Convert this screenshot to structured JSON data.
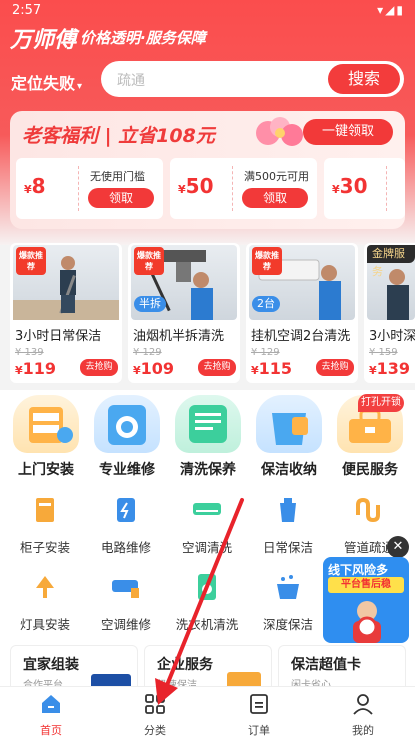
{
  "status": {
    "time": "2:57",
    "icons": "▾◢▮"
  },
  "header": {
    "brand": "万师傅",
    "slogan": "价格透明·服务保障",
    "location": "定位失败",
    "location_arrow": "▾"
  },
  "search": {
    "placeholder": "疏通",
    "button": "搜索"
  },
  "promo": {
    "title": "老客福利 | 立省108元",
    "claim_all": "一键领取",
    "coupons": [
      {
        "currency": "¥",
        "amount": "8",
        "desc": "无使用门槛",
        "button": "领取"
      },
      {
        "currency": "¥",
        "amount": "50",
        "desc": "满500元可用",
        "button": "领取"
      },
      {
        "currency": "¥",
        "amount": "30",
        "desc": "",
        "button": ""
      }
    ]
  },
  "hot_cards": [
    {
      "hot": "爆款推荐",
      "tag": "",
      "name": "3小时日常保洁",
      "old": "¥ 139",
      "currency": "¥",
      "price": "119",
      "buy": "去抢购"
    },
    {
      "hot": "爆款推荐",
      "tag": "半拆",
      "name": "油烟机半拆清洗",
      "old": "¥ 129",
      "currency": "¥",
      "price": "109",
      "buy": "去抢购"
    },
    {
      "hot": "爆款推荐",
      "tag": "2台",
      "name": "挂机空调2台清洗",
      "old": "¥ 129",
      "currency": "¥",
      "price": "115",
      "buy": "去抢购"
    },
    {
      "hot": "",
      "tag": "金牌服务",
      "name": "3小时深",
      "old": "¥ 159",
      "currency": "¥",
      "price": "139",
      "buy": ""
    }
  ],
  "categories": [
    {
      "label": "上门安装",
      "icon": "drawer-icon",
      "color": "#ffb347"
    },
    {
      "label": "专业维修",
      "icon": "washer-icon",
      "color": "#4aa8f0"
    },
    {
      "label": "清洗保养",
      "icon": "card-icon",
      "color": "#3ccf9c"
    },
    {
      "label": "保洁收纳",
      "icon": "bucket-icon",
      "color": "#4aa8f0"
    },
    {
      "label": "便民服务",
      "icon": "toolbox-icon",
      "color": "#ffb347"
    }
  ],
  "badge": "打孔开锁",
  "services": [
    {
      "label": "柜子安装",
      "icon": "cabinet-icon"
    },
    {
      "label": "电路维修",
      "icon": "circuit-icon"
    },
    {
      "label": "空调清洗",
      "icon": "ac-icon"
    },
    {
      "label": "日常保洁",
      "icon": "cleaning-icon"
    },
    {
      "label": "管道疏通",
      "icon": "pipe-icon"
    },
    {
      "label": "灯具安装",
      "icon": "lamp-icon"
    },
    {
      "label": "空调维修",
      "icon": "ac-repair-icon"
    },
    {
      "label": "洗衣机清洗",
      "icon": "washer-clean-icon"
    },
    {
      "label": "深度保洁",
      "icon": "deep-clean-icon"
    }
  ],
  "ad": {
    "line1": "线下风险多",
    "line2": "平台售后稳",
    "close": "✕"
  },
  "bottom_cards": [
    {
      "title": "宜家组装",
      "sub": "合作平台"
    },
    {
      "title": "企业服务",
      "sub": "极速保洁"
    },
    {
      "title": "保洁超值卡",
      "sub": "闲卡省心"
    }
  ],
  "tabs": [
    {
      "label": "首页",
      "icon": "home-icon"
    },
    {
      "label": "分类",
      "icon": "grid-icon"
    },
    {
      "label": "订单",
      "icon": "order-icon"
    },
    {
      "label": "我的",
      "icon": "user-icon"
    }
  ],
  "colors": {
    "primary": "#f23333",
    "header": "#fb4d4d",
    "blue": "#3a8ee8",
    "annotation": "#e8232b"
  }
}
